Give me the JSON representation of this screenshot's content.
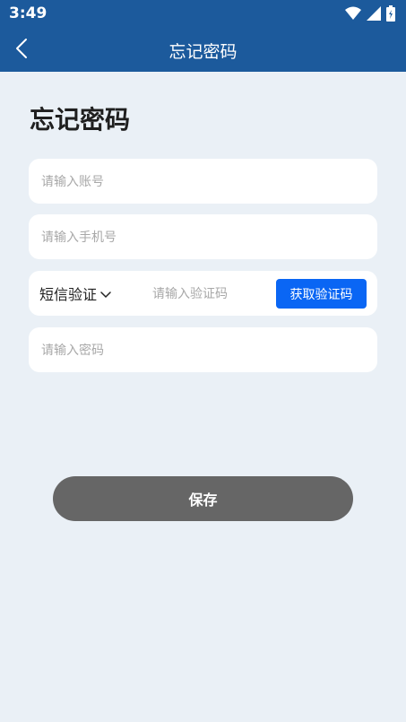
{
  "status_bar": {
    "time": "3:49",
    "icons": [
      "wifi-icon",
      "signal-icon",
      "battery-icon"
    ]
  },
  "header": {
    "title": "忘记密码",
    "back_icon": "chevron-left-icon",
    "background_color": "#1c5a9c"
  },
  "page": {
    "heading": "忘记密码"
  },
  "form": {
    "account_placeholder": "请输入账号",
    "phone_placeholder": "请输入手机号",
    "verify_method": "短信验证",
    "code_placeholder": "请输入验证码",
    "get_code_label": "获取验证码",
    "password_placeholder": "请输入密码"
  },
  "actions": {
    "save_label": "保存"
  },
  "colors": {
    "primary": "#0a66f4",
    "save_button": "#666666",
    "background": "#eaf0f6"
  }
}
